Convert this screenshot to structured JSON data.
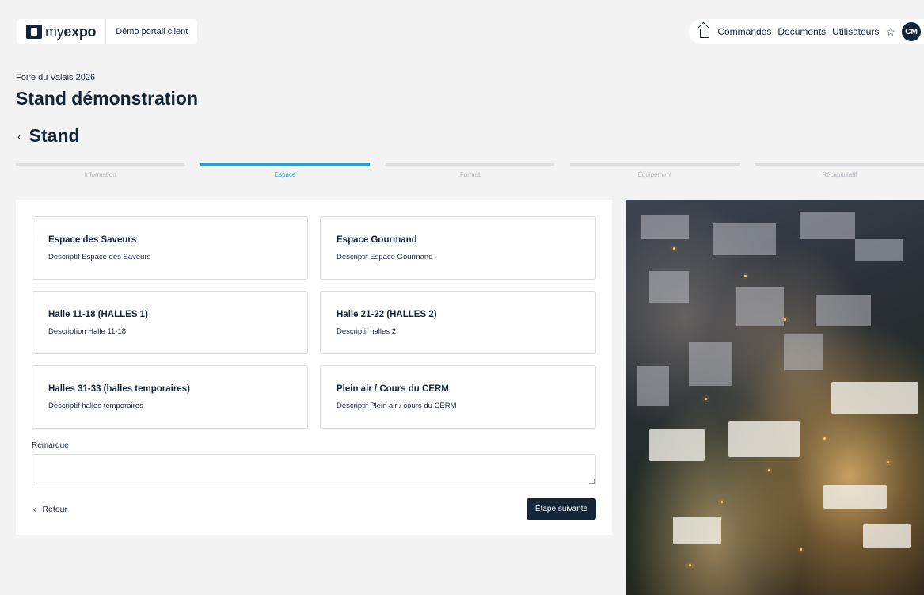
{
  "header": {
    "logo_my": "my",
    "logo_expo": "expo",
    "portal_label": "Démo portail client",
    "nav": [
      "Commandes",
      "Documents",
      "Utilisateurs"
    ],
    "avatar_initials": "CM"
  },
  "page": {
    "event_name": "Foire du Valais 2026",
    "title": "Stand démonstration",
    "section_title": "Stand"
  },
  "steps": [
    {
      "label": "Information",
      "active": false
    },
    {
      "label": "Espace",
      "active": true
    },
    {
      "label": "Format",
      "active": false
    },
    {
      "label": "Équipement",
      "active": false
    },
    {
      "label": "Récapitulatif",
      "active": false
    }
  ],
  "spaces": [
    {
      "title": "Espace des Saveurs",
      "description": "Descriptif Espace des Saveurs"
    },
    {
      "title": "Espace Gourmand",
      "description": "Descriptif Espace Gourmand"
    },
    {
      "title": "Halle 11-18 (HALLES 1)",
      "description": "Description Halle 11-18"
    },
    {
      "title": "Halle 21-22 (HALLES 2)",
      "description": "Descriptif halles 2"
    },
    {
      "title": "Halles 31-33 (halles temporaires)",
      "description": "Descriptif halles temporaires"
    },
    {
      "title": "Plein air / Cours du CERM",
      "description": "Descriptif Plein air / cours du CERM"
    }
  ],
  "form": {
    "remarque_label": "Remarque",
    "remarque_value": "",
    "back_label": "Retour",
    "next_label": "Étape suivante"
  },
  "colors": {
    "primary": "#14253a",
    "accent": "#1ea6d9",
    "background": "#f3f3f4"
  },
  "icons": {
    "home": "home-icon",
    "favorite": "star-icon",
    "back": "chevron-left-icon"
  }
}
